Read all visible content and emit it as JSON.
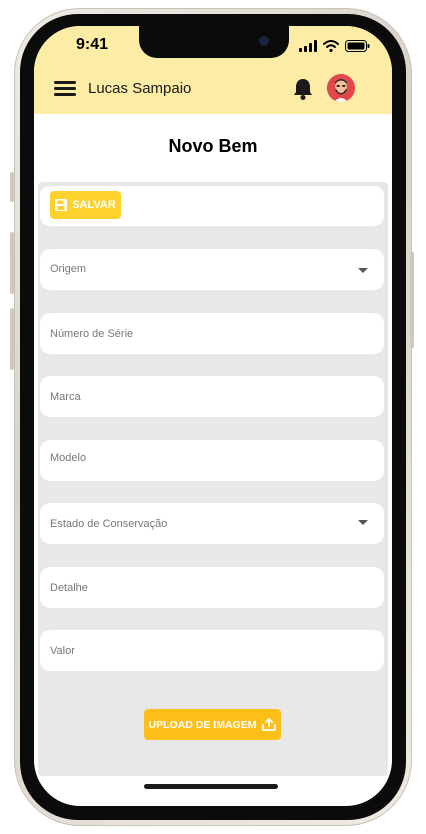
{
  "status_bar": {
    "time": "9:41"
  },
  "header": {
    "user_name": "Lucas Sampaio"
  },
  "page": {
    "title": "Novo Bem"
  },
  "toolbar": {
    "save_label": "SALVAR"
  },
  "form": {
    "fields": [
      {
        "label": "Origem",
        "type": "select"
      },
      {
        "label": "Número de Série",
        "type": "text"
      },
      {
        "label": "Marca",
        "type": "text"
      },
      {
        "label": "Modelo",
        "type": "text"
      },
      {
        "label": "Estado de Conservação",
        "type": "select"
      },
      {
        "label": "Detalhe",
        "type": "text"
      },
      {
        "label": "Valor",
        "type": "text"
      }
    ],
    "upload_label": "UPLOAD DE IMAGEM"
  },
  "icons": {
    "menu": "hamburger-icon",
    "notifications": "bell-icon",
    "save": "floppy-disk-icon",
    "upload": "upload-icon",
    "dropdown": "chevron-down-icon"
  },
  "colors": {
    "header_bg": "#fdeca6",
    "save_button": "#fdd22d",
    "upload_button": "#fdc01b",
    "form_bg": "#e8e8e8",
    "avatar_bg": "#e2474b"
  }
}
